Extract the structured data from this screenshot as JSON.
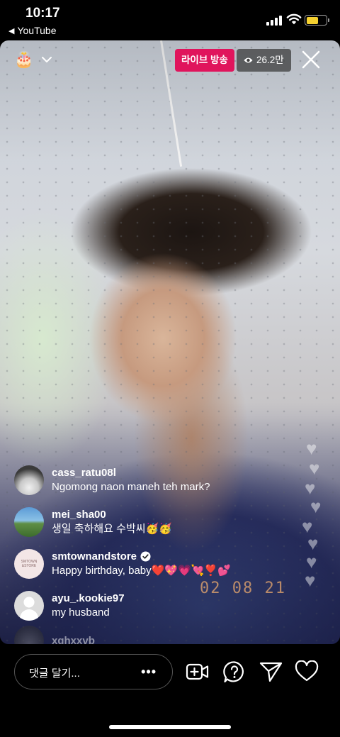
{
  "status_bar": {
    "time": "10:17",
    "back_app": "YouTube",
    "back_arrow": "◀"
  },
  "live": {
    "cake_icon": "🎂",
    "badge": "라이브 방송",
    "viewers": "26.2만",
    "date_stamp": "02 08 21",
    "badge_color": "#e0145c"
  },
  "comments": [
    {
      "user": "cass_ratu08l",
      "text": "Ngomong naon maneh teh mark?"
    },
    {
      "user": "mei_sha00",
      "text": "생일 축하해요 수박씨🥳🥳"
    },
    {
      "user": "smtownandstore",
      "text": "Happy birthday, baby❤️💖💗💘❣️💕",
      "verified": true,
      "avatar_text": "SMTOWN &STORE"
    },
    {
      "user": "ayu_.kookie97",
      "text": "my husband"
    },
    {
      "user": "xghxxvb",
      "text": ""
    }
  ],
  "bottom_bar": {
    "comment_placeholder": "댓글 달기...",
    "more": "•••",
    "icons": [
      "add-video-icon",
      "question-icon",
      "send-icon",
      "heart-icon"
    ]
  }
}
